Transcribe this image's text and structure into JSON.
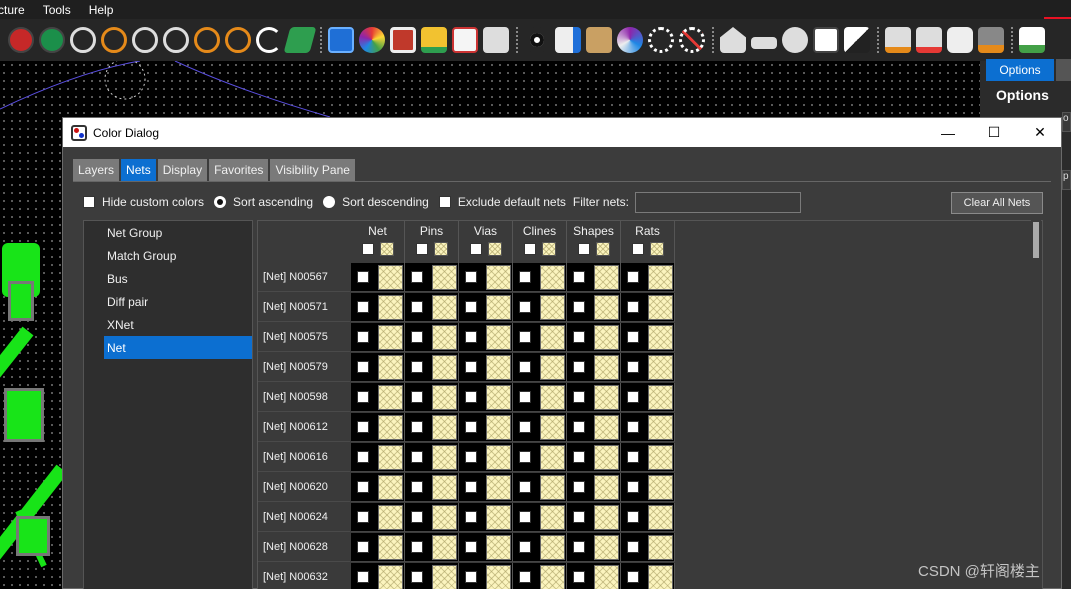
{
  "menu": [
    "cture",
    "Tools",
    "Help"
  ],
  "toolbar": {
    "icons": [
      "unrats-icon",
      "rats-icon",
      "zoom-fit-icon",
      "zoom-prev-icon",
      "zoom-in-icon",
      "zoom-out-icon",
      "zoom-world-icon",
      "zoom-center-icon",
      "redraw-icon",
      "layer-icon",
      "grid-icon",
      "color-icon",
      "shadow-icon",
      "layers-stack-icon",
      "spreadsheet-icon",
      "settings-icon",
      "visibility-eye-icon",
      "info-icon",
      "measure-icon",
      "display-icon",
      "highlight-icon",
      "dehighlight-icon",
      "place-icon",
      "add-connect-icon",
      "slide-icon",
      "select-icon",
      "split-icon",
      "fix-icon",
      "unfix-icon",
      "camera-icon",
      "r2-icon",
      "report-icon"
    ]
  },
  "right_panel": {
    "tab": "Options",
    "title": "Options",
    "strip_letters": [
      "o",
      "p"
    ]
  },
  "dialog": {
    "title": "Color Dialog",
    "window_buttons": [
      "—",
      "☐",
      "✕"
    ],
    "tabs": [
      "Layers",
      "Nets",
      "Display",
      "Favorites",
      "Visibility Pane"
    ],
    "active_tab": "Nets",
    "options": {
      "hide_custom": "Hide custom colors",
      "sort_asc": "Sort ascending",
      "sort_desc": "Sort descending",
      "exclude_default": "Exclude default nets",
      "filter_label": "Filter nets:",
      "filter_value": ""
    },
    "clear_button": "Clear All Nets",
    "groups": [
      "Net Group",
      "Match Group",
      "Bus",
      "Diff pair",
      "XNet",
      "Net"
    ],
    "selected_group": "Net",
    "columns": [
      "Net",
      "Pins",
      "Vias",
      "Clines",
      "Shapes",
      "Rats"
    ],
    "rows": [
      "[Net] N00567",
      "[Net] N00571",
      "[Net] N00575",
      "[Net] N00579",
      "[Net] N00598",
      "[Net] N00612",
      "[Net] N00616",
      "[Net] N00620",
      "[Net] N00624",
      "[Net] N00628",
      "[Net] N00632"
    ],
    "swatch_color": "#fbf4be"
  },
  "watermark": "CSDN @轩阁楼主"
}
